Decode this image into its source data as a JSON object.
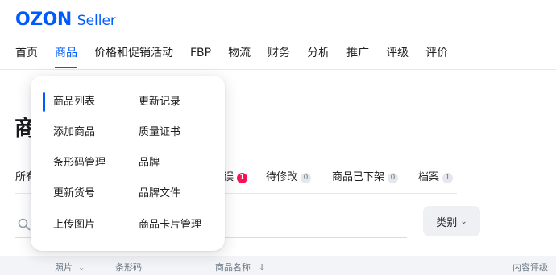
{
  "logo": {
    "word": "OZON",
    "sub": "Seller"
  },
  "nav": {
    "items": [
      "首页",
      "商品",
      "价格和促销活动",
      "FBP",
      "物流",
      "财务",
      "分析",
      "推广",
      "评级",
      "评价"
    ],
    "active_index": 1
  },
  "page": {
    "title_partial": "商"
  },
  "tabs": {
    "all_partial": "所有",
    "errors_partial": "误",
    "errors_count": "1",
    "to_fix": "待修改",
    "to_fix_count": "0",
    "delisted": "商品已下架",
    "delisted_count": "0",
    "archive": "档案",
    "archive_count": "1"
  },
  "filters": {
    "category_label": "类别",
    "category_icon": "chevron-down-icon"
  },
  "table_header": {
    "photo": "照片",
    "barcode": "条形码",
    "name": "商品名称",
    "content_rating": "内容评级"
  },
  "dropdown": {
    "left": [
      "商品列表",
      "添加商品",
      "条形码管理",
      "更新货号",
      "上传图片"
    ],
    "right": [
      "更新记录",
      "质量证书",
      "品牌",
      "品牌文件",
      "商品卡片管理"
    ],
    "active": "商品列表"
  },
  "colors": {
    "brand": "#005bff",
    "badge_red": "#f91155"
  }
}
